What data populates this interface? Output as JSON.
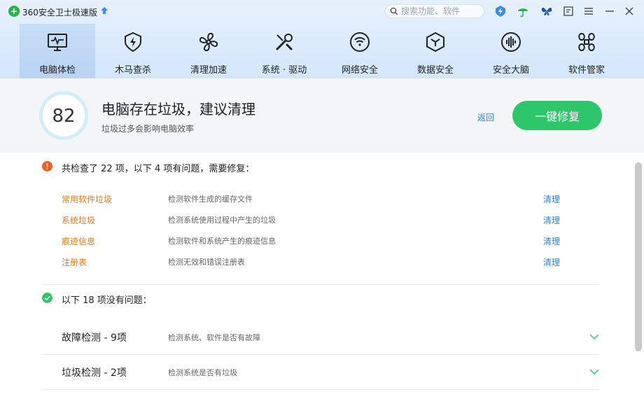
{
  "app": {
    "title": "360安全卫士极速版",
    "logo_char": "+"
  },
  "search": {
    "placeholder": "搜索功能、软件"
  },
  "titlebar_icons": [
    "shield-bolt-icon",
    "umbrella-icon",
    "butterfly-icon",
    "feedback-icon",
    "menu-icon",
    "minimize-icon",
    "close-icon"
  ],
  "nav": [
    {
      "label": "电脑体检",
      "icon": "monitor-pulse-icon",
      "active": true
    },
    {
      "label": "木马查杀",
      "icon": "shield-bolt-icon"
    },
    {
      "label": "清理加速",
      "icon": "fan-icon"
    },
    {
      "label": "系统 · 驱动",
      "icon": "tools-icon"
    },
    {
      "label": "网络安全",
      "icon": "wifi-icon"
    },
    {
      "label": "数据安全",
      "icon": "data-cube-icon"
    },
    {
      "label": "安全大脑",
      "icon": "brain-icon"
    },
    {
      "label": "软件管家",
      "icon": "apps-icon"
    }
  ],
  "status": {
    "score": "82",
    "title": "电脑存在垃圾，建议清理",
    "subtitle": "垃圾过多会影响电脑效率",
    "back_label": "返回",
    "fix_label": "一键修复"
  },
  "issues": {
    "heading": "共检查了 22 项，以下 4 项有问题，需要修复：",
    "rows": [
      {
        "name": "常用软件垃圾",
        "desc": "检测软件生成的缓存文件",
        "action": "清理"
      },
      {
        "name": "系统垃圾",
        "desc": "检测系统使用过程中产生的垃圾",
        "action": "清理"
      },
      {
        "name": "痕迹信息",
        "desc": "检测软件和系统产生的痕迹信息",
        "action": "清理"
      },
      {
        "name": "注册表",
        "desc": "检测无效和错误注册表",
        "action": "清理"
      }
    ]
  },
  "ok": {
    "heading": "以下 18 项没有问题：",
    "rows": [
      {
        "name": "故障检测 - 9项",
        "desc": "检测系统、软件是否有故障"
      },
      {
        "name": "垃圾检测 - 2项",
        "desc": "检测系统是否有垃圾"
      }
    ]
  },
  "colors": {
    "accent_green": "#2dc66b",
    "warning": "#f05a24",
    "issue_text": "#e07b1c",
    "link": "#2e82d6"
  }
}
